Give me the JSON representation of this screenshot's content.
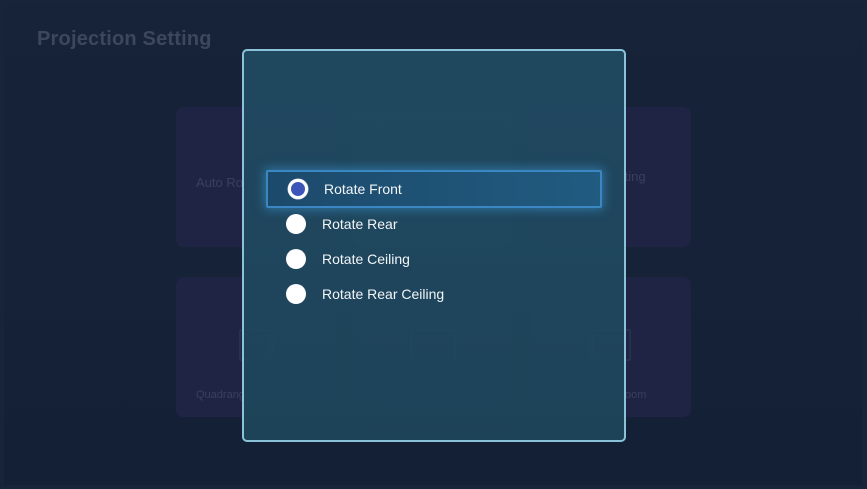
{
  "page": {
    "title": "Projection Setting"
  },
  "background_tiles": [
    {
      "label": "Auto Ro",
      "has_icon": false
    },
    {
      "label": "",
      "has_icon": false
    },
    {
      "label": "tting",
      "has_icon": false
    },
    {
      "label": "Quadrang",
      "has_icon": true
    },
    {
      "label": "",
      "has_icon": true
    },
    {
      "label": "oom",
      "has_icon": true
    }
  ],
  "dialog": {
    "options": [
      {
        "label": "Rotate Front",
        "selected": true,
        "focused": true
      },
      {
        "label": "Rotate Rear",
        "selected": false,
        "focused": false
      },
      {
        "label": "Rotate Ceiling",
        "selected": false,
        "focused": false
      },
      {
        "label": "Rotate Rear Ceiling",
        "selected": false,
        "focused": false
      }
    ]
  },
  "colors": {
    "accent": "#3d55b8",
    "focus_border": "#3b87c3",
    "dialog_border": "#8ac3d9"
  }
}
